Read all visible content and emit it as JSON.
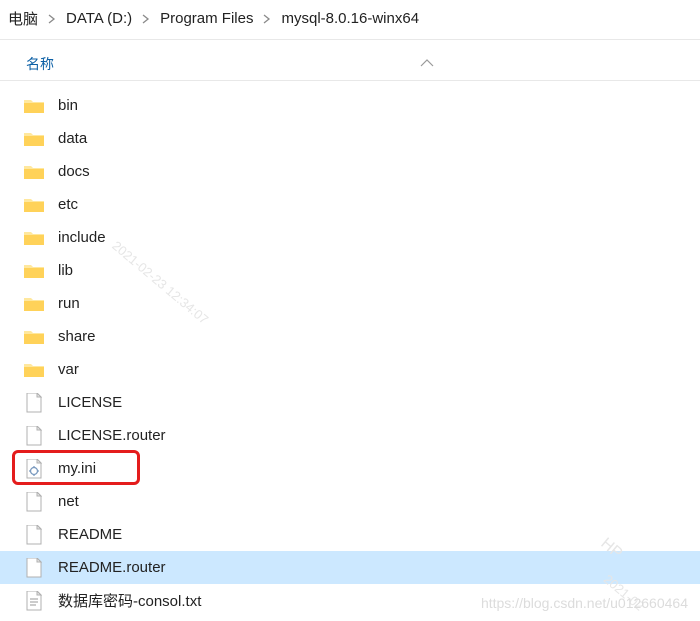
{
  "breadcrumb": {
    "crumb0": "电脑",
    "crumb1": "DATA (D:)",
    "crumb2": "Program Files",
    "crumb3": "mysql-8.0.16-winx64"
  },
  "header": {
    "name_col": "名称"
  },
  "files": [
    {
      "name": "bin",
      "type": "folder"
    },
    {
      "name": "data",
      "type": "folder"
    },
    {
      "name": "docs",
      "type": "folder"
    },
    {
      "name": "etc",
      "type": "folder"
    },
    {
      "name": "include",
      "type": "folder"
    },
    {
      "name": "lib",
      "type": "folder"
    },
    {
      "name": "run",
      "type": "folder"
    },
    {
      "name": "share",
      "type": "folder"
    },
    {
      "name": "var",
      "type": "folder"
    },
    {
      "name": "LICENSE",
      "type": "file"
    },
    {
      "name": "LICENSE.router",
      "type": "file"
    },
    {
      "name": "my.ini",
      "type": "ini",
      "highlighted": true
    },
    {
      "name": "net",
      "type": "file"
    },
    {
      "name": "README",
      "type": "file"
    },
    {
      "name": "README.router",
      "type": "file",
      "selected": true
    },
    {
      "name": "数据库密码-consol.txt",
      "type": "txt"
    }
  ],
  "watermarks": {
    "diag1": "2021-02-23 12:34:07",
    "diag2": "HP",
    "diag3": "2021-02",
    "bottom": "https://blog.csdn.net/u012660464"
  }
}
